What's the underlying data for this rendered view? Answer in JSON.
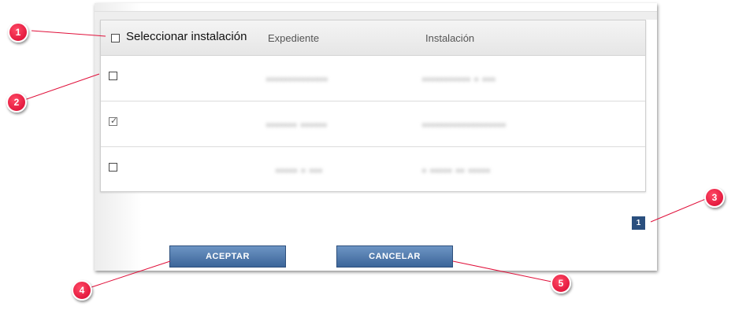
{
  "grid": {
    "select_all_label": "Seleccionar instalación",
    "columns": {
      "expediente": "Expediente",
      "instalacion": "Instalación"
    },
    "rows": [
      {
        "checked": false,
        "expediente": "▪▪▪▪▪▪▪▪▪▪▪▪▪▪",
        "instalacion": "▪▪▪▪▪▪▪▪▪▪▪ ▪ ▪▪▪"
      },
      {
        "checked": true,
        "expediente": "▪▪▪▪▪▪▪ ▪▪▪▪▪▪",
        "instalacion": "▪▪▪▪▪▪▪▪▪▪▪▪▪▪▪▪▪▪▪"
      },
      {
        "checked": false,
        "expediente": "▪▪▪▪▪ ▪ ▪▪▪",
        "instalacion": "▪ ▪▪▪▪▪ ▪▪ ▪▪▪▪▪"
      }
    ],
    "checkmark_glyph": "✓"
  },
  "pagination": {
    "current_page": "1"
  },
  "buttons": {
    "accept": "ACEPTAR",
    "cancel": "CANCELAR"
  },
  "callouts": [
    "1",
    "2",
    "3",
    "4",
    "5"
  ],
  "colors": {
    "callout_red": "#e0103a",
    "button_blue": "#4f78aa",
    "pager_blue": "#2a4f7e"
  }
}
